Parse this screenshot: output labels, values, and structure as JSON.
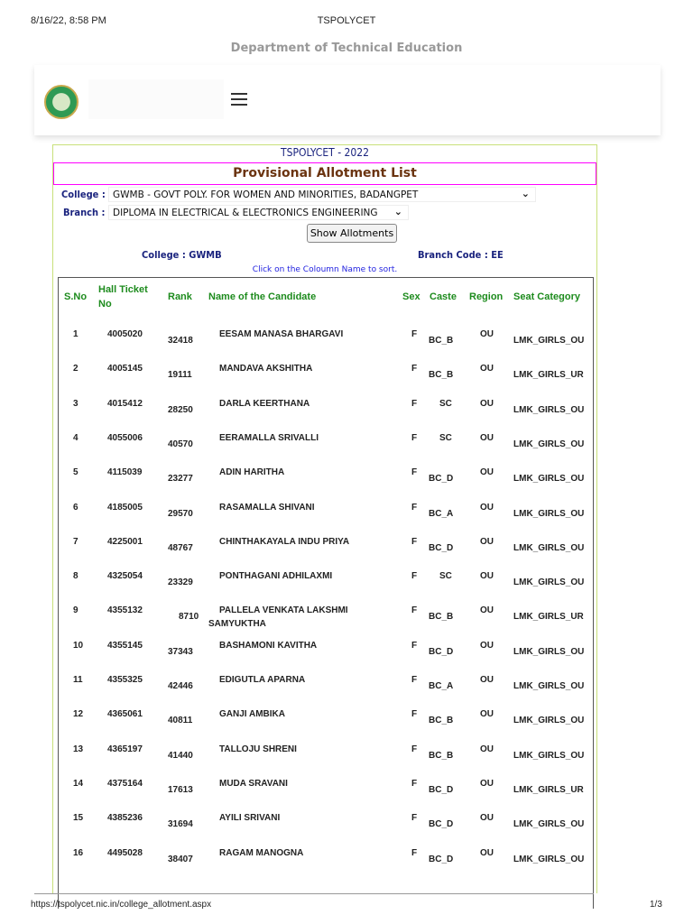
{
  "print_header": {
    "datetime": "8/16/22, 8:58 PM",
    "title": "TSPOLYCET"
  },
  "site": {
    "department": "Department of Technical Education"
  },
  "page": {
    "exam_title": "TSPOLYCET - 2022",
    "list_title": "Provisional Allotment List"
  },
  "form": {
    "college_label": "College :",
    "college_value": "GWMB - GOVT POLY. FOR WOMEN AND MINORITIES, BADANGPET",
    "branch_label": "Branch :",
    "branch_value": "DIPLOMA IN ELECTRICAL & ELECTRONICS ENGINEERING",
    "show_button": "Show Allotments"
  },
  "summary": {
    "college": "College : GWMB",
    "branch_code": "Branch Code : EE",
    "sort_hint": "Click on the Coloumn Name to sort."
  },
  "table": {
    "headers": {
      "sno": "S.No",
      "hall1": "Hall Ticket",
      "hall2": "No",
      "rank": "Rank",
      "name": "Name of the Candidate",
      "sex": "Sex",
      "caste": "Caste",
      "region": "Region",
      "seat": "Seat Category"
    },
    "rows": [
      {
        "sno": "1",
        "hall": "4005020",
        "rank": "32418",
        "name": "EESAM MANASA BHARGAVI",
        "name2": "",
        "sex": "F",
        "caste": "BC_B",
        "region": "OU",
        "seat": "LMK_GIRLS_OU"
      },
      {
        "sno": "2",
        "hall": "4005145",
        "rank": "19111",
        "name": "MANDAVA AKSHITHA",
        "name2": "",
        "sex": "F",
        "caste": "BC_B",
        "region": "OU",
        "seat": "LMK_GIRLS_UR"
      },
      {
        "sno": "3",
        "hall": "4015412",
        "rank": "28250",
        "name": "DARLA KEERTHANA",
        "name2": "",
        "sex": "F",
        "caste": "SC",
        "region": "OU",
        "seat": "LMK_GIRLS_OU"
      },
      {
        "sno": "4",
        "hall": "4055006",
        "rank": "40570",
        "name": "EERAMALLA SRIVALLI",
        "name2": "",
        "sex": "F",
        "caste": "SC",
        "region": "OU",
        "seat": "LMK_GIRLS_OU"
      },
      {
        "sno": "5",
        "hall": "4115039",
        "rank": "23277",
        "name": "ADIN HARITHA",
        "name2": "",
        "sex": "F",
        "caste": "BC_D",
        "region": "OU",
        "seat": "LMK_GIRLS_OU"
      },
      {
        "sno": "6",
        "hall": "4185005",
        "rank": "29570",
        "name": "RASAMALLA SHIVANI",
        "name2": "",
        "sex": "F",
        "caste": "BC_A",
        "region": "OU",
        "seat": "LMK_GIRLS_OU"
      },
      {
        "sno": "7",
        "hall": "4225001",
        "rank": "48767",
        "name": "CHINTHAKAYALA INDU PRIYA",
        "name2": "",
        "sex": "F",
        "caste": "BC_D",
        "region": "OU",
        "seat": "LMK_GIRLS_OU"
      },
      {
        "sno": "8",
        "hall": "4325054",
        "rank": "23329",
        "name": "PONTHAGANI ADHILAXMI",
        "name2": "",
        "sex": "F",
        "caste": "SC",
        "region": "OU",
        "seat": "LMK_GIRLS_OU"
      },
      {
        "sno": "9",
        "hall": "4355132",
        "rank": "8710",
        "name": "PALLELA VENKATA LAKSHMI",
        "name2": "SAMYUKTHA",
        "sex": "F",
        "caste": "BC_B",
        "region": "OU",
        "seat": "LMK_GIRLS_UR"
      },
      {
        "sno": "10",
        "hall": "4355145",
        "rank": "37343",
        "name": "BASHAMONI KAVITHA",
        "name2": "",
        "sex": "F",
        "caste": "BC_D",
        "region": "OU",
        "seat": "LMK_GIRLS_OU"
      },
      {
        "sno": "11",
        "hall": "4355325",
        "rank": "42446",
        "name": "EDIGUTLA APARNA",
        "name2": "",
        "sex": "F",
        "caste": "BC_A",
        "region": "OU",
        "seat": "LMK_GIRLS_OU"
      },
      {
        "sno": "12",
        "hall": "4365061",
        "rank": "40811",
        "name": "GANJI AMBIKA",
        "name2": "",
        "sex": "F",
        "caste": "BC_B",
        "region": "OU",
        "seat": "LMK_GIRLS_OU"
      },
      {
        "sno": "13",
        "hall": "4365197",
        "rank": "41440",
        "name": "TALLOJU SHRENI",
        "name2": "",
        "sex": "F",
        "caste": "BC_B",
        "region": "OU",
        "seat": "LMK_GIRLS_OU"
      },
      {
        "sno": "14",
        "hall": "4375164",
        "rank": "17613",
        "name": "MUDA SRAVANI",
        "name2": "",
        "sex": "F",
        "caste": "BC_D",
        "region": "OU",
        "seat": "LMK_GIRLS_UR"
      },
      {
        "sno": "15",
        "hall": "4385236",
        "rank": "31694",
        "name": "AYILI SRIVANI",
        "name2": "",
        "sex": "F",
        "caste": "BC_D",
        "region": "OU",
        "seat": "LMK_GIRLS_OU"
      },
      {
        "sno": "16",
        "hall": "4495028",
        "rank": "38407",
        "name": "RAGAM MANOGNA",
        "name2": "",
        "sex": "F",
        "caste": "BC_D",
        "region": "OU",
        "seat": "LMK_GIRLS_OU"
      }
    ]
  },
  "print_footer": {
    "url": "https://tspolycet.nic.in/college_allotment.aspx",
    "page": "1/3"
  }
}
